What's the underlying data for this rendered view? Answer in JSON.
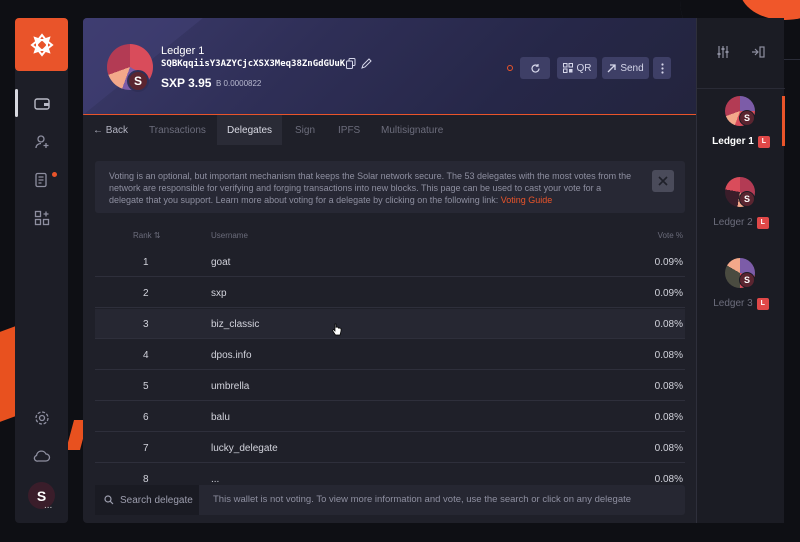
{
  "app": {
    "accent": "#e9542a"
  },
  "sidebar": {
    "icons": [
      "wallet-icon",
      "contacts-icon",
      "transactions-icon",
      "plugins-icon",
      "settings-icon",
      "cloud-icon"
    ],
    "profile_initial": "S",
    "profile_more": "..."
  },
  "wallet": {
    "name": "Ledger 1",
    "address": "SQBKqqiisY3AZYCjcXSX3Meq38ZnGdGUuK",
    "balance": "SXP 3.95",
    "balance_btc": "B 0.0000822",
    "avatar_initial": "S"
  },
  "header_buttons": {
    "qr": "QR",
    "send": "Send"
  },
  "tabs": [
    {
      "label": "← Back",
      "active": false
    },
    {
      "label": "Transactions",
      "active": false
    },
    {
      "label": "Delegates",
      "active": true
    },
    {
      "label": "Sign",
      "active": false
    },
    {
      "label": "IPFS",
      "active": false
    },
    {
      "label": "Multisignature",
      "active": false
    }
  ],
  "notice": {
    "text": "Voting is an optional, but important mechanism that keeps the Solar network secure. The 53 delegates with the most votes from the network are responsible for verifying and forging transactions into new blocks. This page can be used to cast your vote for a delegate that you support. Learn more about voting for a delegate by clicking on the following link: ",
    "link": "Voting Guide"
  },
  "table": {
    "headers": {
      "rank": "Rank ⇅",
      "username": "Username",
      "vote": "Vote %"
    },
    "rows": [
      {
        "rank": "1",
        "username": "goat",
        "vote": "0.09%"
      },
      {
        "rank": "2",
        "username": "sxp",
        "vote": "0.09%"
      },
      {
        "rank": "3",
        "username": "biz_classic",
        "vote": "0.08%"
      },
      {
        "rank": "4",
        "username": "dpos.info",
        "vote": "0.08%"
      },
      {
        "rank": "5",
        "username": "umbrella",
        "vote": "0.08%"
      },
      {
        "rank": "6",
        "username": "balu",
        "vote": "0.08%"
      },
      {
        "rank": "7",
        "username": "lucky_delegate",
        "vote": "0.08%"
      },
      {
        "rank": "8",
        "username": "...",
        "vote": "0.08%"
      }
    ]
  },
  "footer": {
    "search_label": "Search delegate",
    "message": "This wallet is not voting. To view more information and vote, use the search or click on any delegate"
  },
  "wallets_panel": {
    "items": [
      {
        "label": "Ledger 1",
        "badge": "L",
        "active": true,
        "initial": "S"
      },
      {
        "label": "Ledger 2",
        "badge": "L",
        "active": false,
        "initial": "S"
      },
      {
        "label": "Ledger 3",
        "badge": "L",
        "active": false,
        "initial": "S"
      }
    ]
  }
}
